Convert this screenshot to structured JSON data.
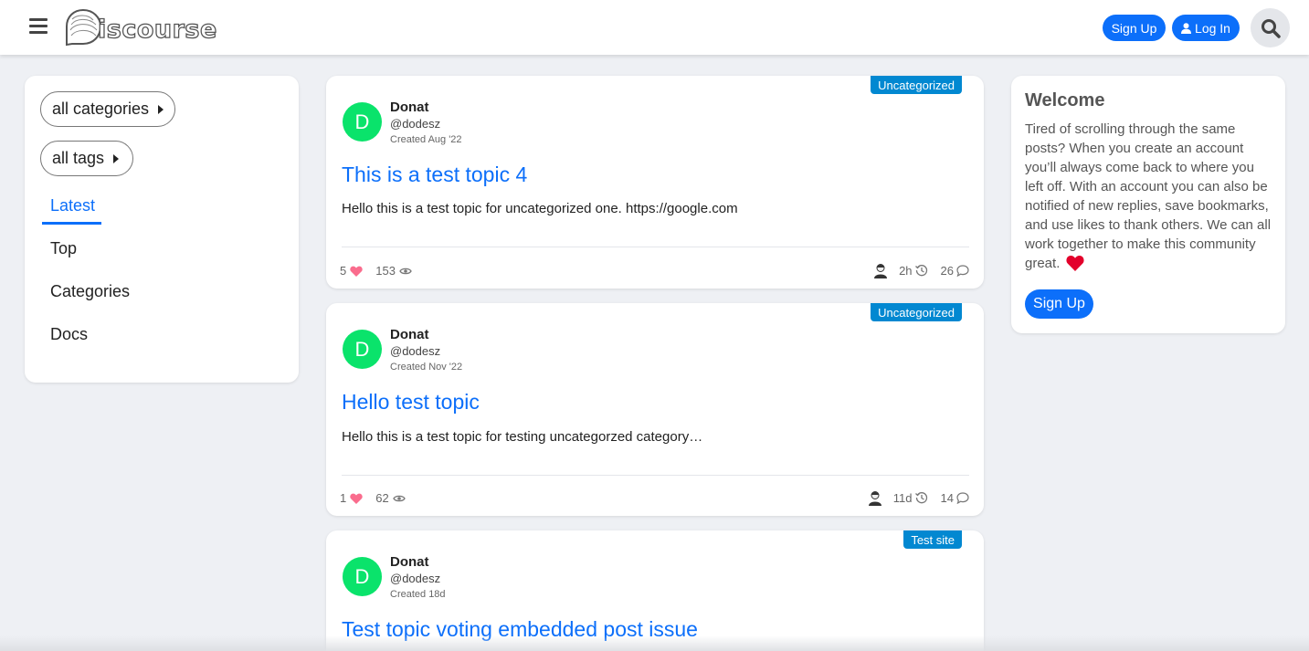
{
  "header": {
    "logo_text": "iscourse",
    "signup_label": "Sign Up",
    "login_label": "Log In"
  },
  "sidebar": {
    "categories_pill": "all categories",
    "tags_pill": "all tags",
    "nav": [
      "Latest",
      "Top",
      "Categories",
      "Docs"
    ]
  },
  "topics": [
    {
      "category": "Uncategorized",
      "avatar_letter": "D",
      "author": "Donat",
      "handle": "@dodesz",
      "created": "Created Aug '22",
      "title": "This is a test topic 4",
      "excerpt": "Hello this is a test topic for uncategorized one. https://google.com",
      "likes": "5",
      "views": "153",
      "activity": "2h",
      "replies": "26"
    },
    {
      "category": "Uncategorized",
      "avatar_letter": "D",
      "author": "Donat",
      "handle": "@dodesz",
      "created": "Created Nov '22",
      "title": "Hello test topic",
      "excerpt": "Hello this is a test topic for testing uncategorzed category…",
      "likes": "1",
      "views": "62",
      "activity": "11d",
      "replies": "14"
    },
    {
      "category": "Test site",
      "avatar_letter": "D",
      "author": "Donat",
      "handle": "@dodesz",
      "created": "Created 18d",
      "title": "Test topic voting embedded post issue"
    }
  ],
  "welcome": {
    "title": "Welcome",
    "body": "Tired of scrolling through the same posts? When you create an account you’ll always come back to where you left off. With an account you can also be notified of new replies, save bookmarks, and use likes to thank others. We can all work together to make this community great.",
    "signup_label": "Sign Up"
  },
  "colors": {
    "accent": "#0c6ffa",
    "category_badge": "#0288d1",
    "avatar": "#0ae36b",
    "like_heart": "#fa6c8d",
    "welcome_heart": "#e3002b"
  }
}
